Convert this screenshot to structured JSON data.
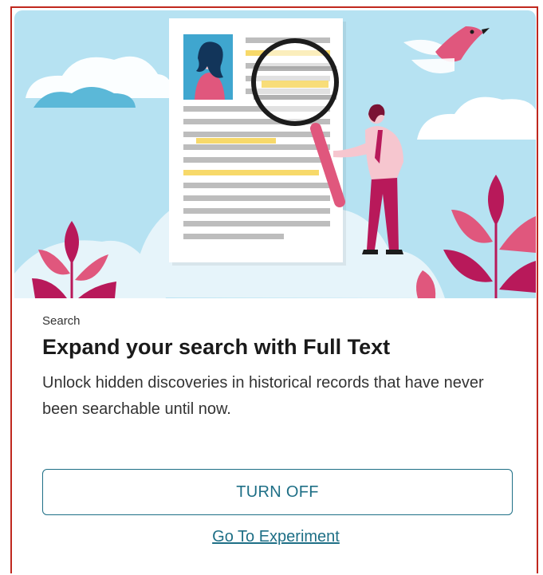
{
  "card": {
    "eyebrow": "Search",
    "title": "Expand your search with Full Text",
    "description": "Unlock hidden discoveries in historical records that have never been searchable until now.",
    "turn_off_label": "TURN OFF",
    "experiment_link_label": "Go To Experiment"
  },
  "illustration": {
    "icons": [
      "document-icon",
      "magnifier-icon",
      "person-icon",
      "bird-icon",
      "leaf-plant-icon",
      "cloud-icon"
    ]
  },
  "colors": {
    "accent": "#1e6f86",
    "sky": "#b6e2f2",
    "border": "#c0281e",
    "pink": "#e0577d",
    "magenta": "#b8195a",
    "highlight": "#f7d96a"
  }
}
